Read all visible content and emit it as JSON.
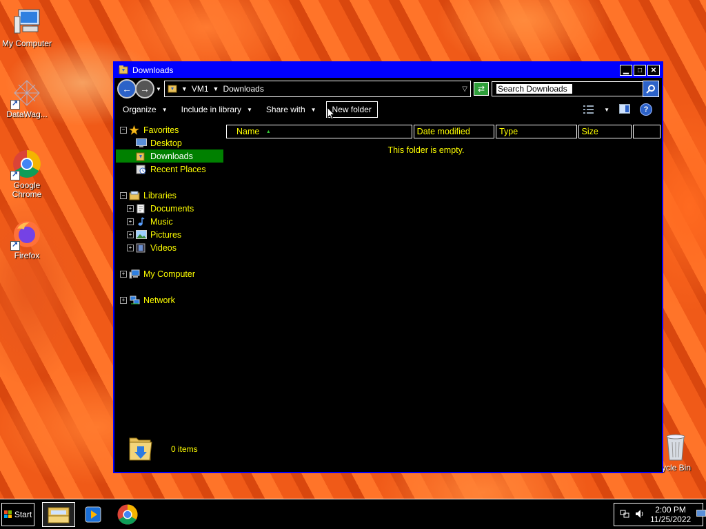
{
  "desktop": {
    "icons": [
      {
        "label": "My Computer",
        "icon": "computer-icon"
      },
      {
        "label": "DataWag...",
        "icon": "datawag-icon"
      },
      {
        "label": "Google Chrome",
        "icon": "chrome-icon"
      },
      {
        "label": "Firefox",
        "icon": "firefox-icon"
      },
      {
        "label": "ycle Bin",
        "icon": "recycle-bin-icon"
      }
    ]
  },
  "window": {
    "title": "Downloads",
    "address": {
      "segments": [
        "VM1",
        "Downloads"
      ]
    },
    "search": {
      "value": "Search Downloads"
    },
    "toolbar": {
      "organize": "Organize",
      "include_in_library": "Include in library",
      "share_with": "Share with",
      "new_folder": "New folder"
    },
    "nav": {
      "favorites": "Favorites",
      "desktop": "Desktop",
      "downloads": "Downloads",
      "recent_places": "Recent Places",
      "libraries": "Libraries",
      "documents": "Documents",
      "music": "Music",
      "pictures": "Pictures",
      "videos": "Videos",
      "my_computer": "My Computer",
      "network": "Network"
    },
    "columns": {
      "name": "Name",
      "date_modified": "Date modified",
      "type": "Type",
      "size": "Size"
    },
    "empty_message": "This folder is empty.",
    "details": {
      "items": "0 items"
    }
  },
  "taskbar": {
    "start": "Start",
    "clock": {
      "time": "2:00 PM",
      "date": "11/25/2022"
    }
  },
  "colors": {
    "title_bar": "#0000ff",
    "accent_text": "#ffff00",
    "selection": "#008000"
  }
}
